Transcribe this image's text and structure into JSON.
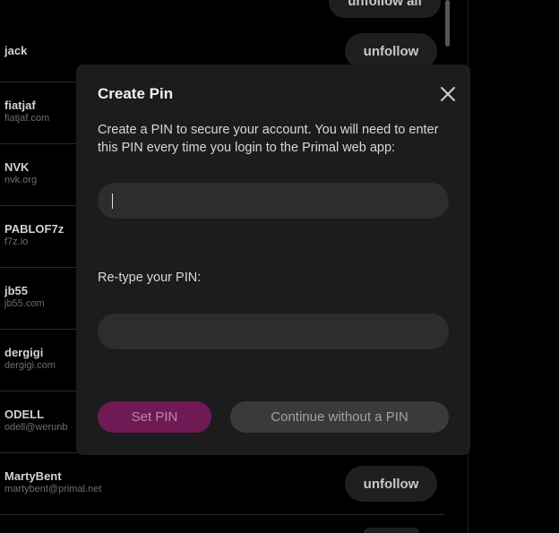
{
  "list": {
    "unfollow_all_label": "unfollow all",
    "unfollow_label": "unfollow",
    "rows": [
      {
        "name": "jack",
        "nip05": ""
      },
      {
        "name": "fiatjaf",
        "nip05": "fiatjaf.com"
      },
      {
        "name": "NVK",
        "nip05": "nvk.org"
      },
      {
        "name": "PABLOF7z",
        "nip05": "f7z.io"
      },
      {
        "name": "jb55",
        "nip05": "jb55.com"
      },
      {
        "name": "dergigi",
        "nip05": "dergigi.com"
      },
      {
        "name": "ODELL",
        "nip05": "odell@werunb"
      },
      {
        "name": "MartyBent",
        "nip05": "martybent@primal.net"
      }
    ]
  },
  "modal": {
    "title": "Create Pin",
    "description": "Create a PIN to secure your account. You will need to enter this PIN every time you login to the Primal web app:",
    "pin_value": "",
    "retype_label": "Re-type your PIN:",
    "retype_value": "",
    "set_pin_label": "Set PIN",
    "continue_label": "Continue without a PIN"
  },
  "colors": {
    "background": "#000000",
    "modal_background": "#1c1c1c",
    "input_background": "#2d2d2d",
    "accent": "#6f1a55",
    "secondary_button": "#3a3a3a"
  },
  "icons": {
    "close": "close-icon"
  }
}
